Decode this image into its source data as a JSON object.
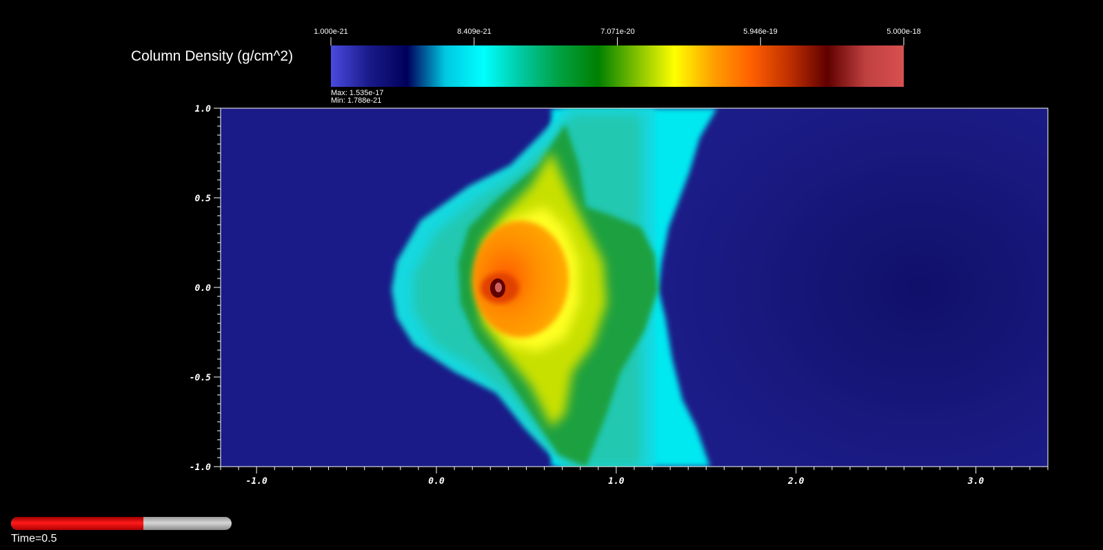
{
  "colorbar": {
    "title": "Column Density (g/cm^2)",
    "tick_labels": [
      "1.000e-21",
      "8.409e-21",
      "7.071e-20",
      "5.946e-19",
      "5.000e-18"
    ],
    "max_label": "Max:  1.535e-17",
    "min_label": "Min:  1.788e-21",
    "colors": [
      "#4a4ae0",
      "#1a1a8a",
      "#00005a",
      "#00c8e0",
      "#00ffff",
      "#00c8a0",
      "#00a040",
      "#008000",
      "#80c000",
      "#ffff00",
      "#ffa000",
      "#ff6000",
      "#c03000",
      "#600000",
      "#c04040",
      "#d85050"
    ]
  },
  "chart_data": {
    "type": "heatmap",
    "title": "",
    "xlabel": "",
    "ylabel": "",
    "xlim": [
      -1.2,
      3.4
    ],
    "ylim": [
      -1.0,
      1.0
    ],
    "x_ticks": [
      "-1.0",
      "0.0",
      "1.0",
      "2.0",
      "3.0"
    ],
    "x_tick_values": [
      -1.0,
      0.0,
      1.0,
      2.0,
      3.0
    ],
    "y_ticks": [
      "1.0",
      "0.5",
      "0.0",
      "-0.5",
      "-1.0"
    ],
    "y_tick_values": [
      1.0,
      0.5,
      0.0,
      -0.5,
      -1.0
    ],
    "colorscale": "log",
    "clim": [
      1e-21,
      5e-18
    ],
    "data_max": 1.535e-17,
    "data_min": 1.788e-21,
    "features": [
      {
        "name": "dense core",
        "x": 0.37,
        "y": 0.0
      },
      {
        "name": "shell left edge",
        "x": -0.25,
        "y": 0.0
      },
      {
        "name": "shell top",
        "x": 0.75,
        "y": 1.0
      },
      {
        "name": "shell bottom",
        "x": 0.72,
        "y": -1.0
      }
    ],
    "grid": false
  },
  "time": {
    "label": "Time=0.5",
    "progress": 0.6
  }
}
